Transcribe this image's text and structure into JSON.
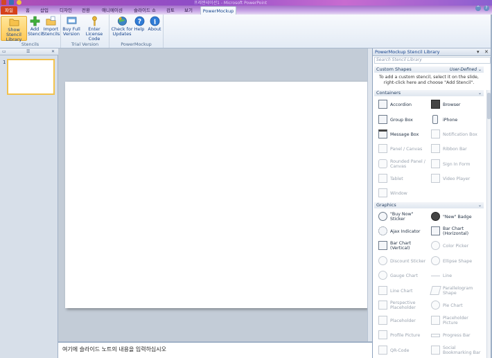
{
  "window": {
    "title": "프레젠테이션1 - Microsoft PowerPoint"
  },
  "ribbon_tabs": [
    {
      "label": "파일"
    },
    {
      "label": "홈"
    },
    {
      "label": "삽입"
    },
    {
      "label": "디자인"
    },
    {
      "label": "전환"
    },
    {
      "label": "애니메이션"
    },
    {
      "label": "슬라이드 쇼"
    },
    {
      "label": "검토"
    },
    {
      "label": "보기"
    },
    {
      "label": "PowerMockup"
    }
  ],
  "ribbon": {
    "groups": [
      {
        "label": "Stencils"
      },
      {
        "label": "Trial Version"
      },
      {
        "label": "PowerMockup"
      }
    ],
    "buttons": [
      {
        "label1": "Show Stencil",
        "label2": "Library"
      },
      {
        "label1": "Add",
        "label2": "Stencil"
      },
      {
        "label1": "Import",
        "label2": "Stencils"
      },
      {
        "label1": "Buy Full",
        "label2": "Version"
      },
      {
        "label1": "Enter License",
        "label2": "Code"
      },
      {
        "label1": "Check for",
        "label2": "Updates"
      },
      {
        "label1": "Help",
        "label2": ""
      },
      {
        "label1": "About",
        "label2": ""
      }
    ]
  },
  "thumbnails": {
    "slide_number": "1"
  },
  "notes": {
    "placeholder": "여기에 슬라이드 노트의 내용을 입력하십시오"
  },
  "library": {
    "title": "PowerMockup Stencil Library",
    "search_placeholder": "Search Stencil Library",
    "custom_shapes": {
      "header": "Custom Shapes",
      "filter": "User-Defined",
      "message": "To add a custom stencil, select it on the slide, right-click here and choose \"Add Stencil\"."
    },
    "containers": {
      "header": "Containers",
      "items": [
        {
          "label": "Accordion"
        },
        {
          "label": "Browser"
        },
        {
          "label": "Group Box"
        },
        {
          "label": "iPhone"
        },
        {
          "label": "Message Box"
        },
        {
          "label": "Notification Box"
        },
        {
          "label": "Panel / Canvas"
        },
        {
          "label": "Ribbon Bar"
        },
        {
          "label": "Rounded Panel / Canvas"
        },
        {
          "label": "Sign In Form"
        },
        {
          "label": "Tablet"
        },
        {
          "label": "Video Player"
        },
        {
          "label": "Window"
        }
      ]
    },
    "graphics": {
      "header": "Graphics",
      "items": [
        {
          "label": "\"Buy Now\" Sticker"
        },
        {
          "label": "\"New\" Badge"
        },
        {
          "label": "Ajax Indicator"
        },
        {
          "label": "Bar Chart (Horizontal)"
        },
        {
          "label": "Bar Chart (Vertical)"
        },
        {
          "label": "Color Picker"
        },
        {
          "label": "Discount Sticker"
        },
        {
          "label": "Ellipse Shape"
        },
        {
          "label": "Gauge Chart"
        },
        {
          "label": "Line"
        },
        {
          "label": "Line Chart"
        },
        {
          "label": "Parallelogram Shape"
        },
        {
          "label": "Perspective Placeholder"
        },
        {
          "label": "Pie Chart"
        },
        {
          "label": "Placeholder"
        },
        {
          "label": "Placeholder Picture"
        },
        {
          "label": "Profile Picture"
        },
        {
          "label": "Progress Bar"
        },
        {
          "label": "QR-Code"
        },
        {
          "label": "Social Bookmarking Bar"
        }
      ]
    }
  },
  "colors": {
    "file_tab": "#d5421b",
    "selected_button": "#ffc956",
    "accent": "#15428b"
  }
}
